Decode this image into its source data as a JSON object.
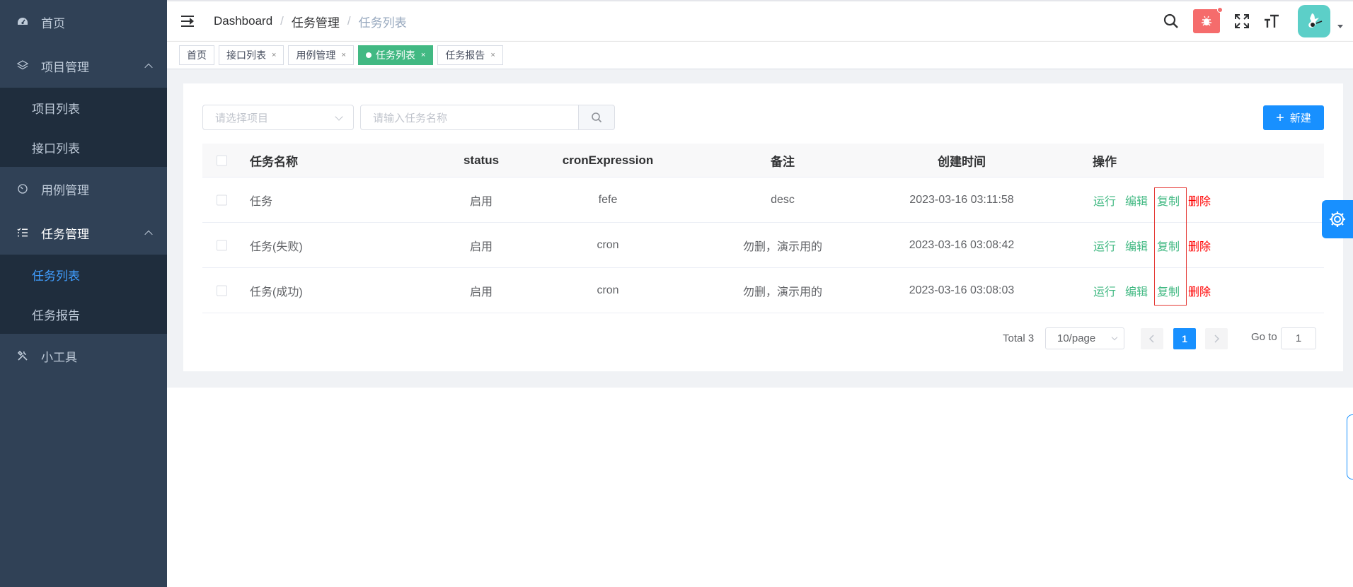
{
  "sidebar": {
    "items": [
      {
        "label": "首页",
        "icon": "dashboard-icon"
      },
      {
        "label": "项目管理",
        "icon": "layers-icon",
        "children": [
          "项目列表",
          "接口列表"
        ]
      },
      {
        "label": "用例管理",
        "icon": "gauge-icon"
      },
      {
        "label": "任务管理",
        "icon": "list-icon",
        "children": [
          "任务列表",
          "任务报告"
        ]
      },
      {
        "label": "小工具",
        "icon": "tools-icon"
      }
    ]
  },
  "breadcrumb": [
    "Dashboard",
    "任务管理",
    "任务列表"
  ],
  "tags": [
    {
      "label": "首页"
    },
    {
      "label": "接口列表"
    },
    {
      "label": "用例管理"
    },
    {
      "label": "任务列表"
    },
    {
      "label": "任务报告"
    }
  ],
  "filters": {
    "project_placeholder": "请选择项目",
    "name_placeholder": "请输入任务名称",
    "new_button": "新建"
  },
  "table": {
    "columns": [
      "任务名称",
      "status",
      "cronExpression",
      "备注",
      "创建时间",
      "操作"
    ],
    "rows": [
      {
        "name": "任务",
        "status": "启用",
        "cron": "fefe",
        "remark": "desc",
        "created": "2023-03-16 03:11:58"
      },
      {
        "name": "任务(失败)",
        "status": "启用",
        "cron": "cron",
        "remark": "勿删，演示用的",
        "created": "2023-03-16 03:08:42"
      },
      {
        "name": "任务(成功)",
        "status": "启用",
        "cron": "cron",
        "remark": "勿删，演示用的",
        "created": "2023-03-16 03:08:03"
      }
    ],
    "actions": {
      "run": "运行",
      "edit": "编辑",
      "copy": "复制",
      "delete": "删除"
    }
  },
  "pagination": {
    "total": "Total 3",
    "page_size": "10/page",
    "current_page": "1",
    "goto_label": "Go to",
    "goto_value": "1"
  },
  "colors": {
    "sidebar_bg": "#304156",
    "active_tag": "#42b983",
    "primary": "#1890ff",
    "action_green": "#42b983",
    "action_red": "#ff0000"
  }
}
